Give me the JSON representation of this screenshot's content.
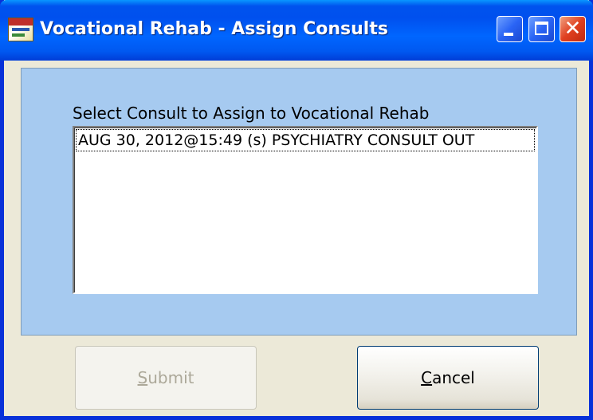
{
  "window": {
    "title": "Vocational Rehab - Assign Consults",
    "buttons": {
      "minimize_icon": "minimize-icon",
      "maximize_icon": "maximize-icon",
      "close_icon": "close-icon"
    }
  },
  "form": {
    "list_label": "Select Consult to Assign to Vocational Rehab",
    "items": [
      {
        "label": "AUG 30, 2012@15:49 (s) PSYCHIATRY CONSULT OUT"
      }
    ],
    "submit": {
      "accel": "S",
      "rest": "ubmit",
      "enabled": false
    },
    "cancel": {
      "accel": "C",
      "rest": "ancel",
      "enabled": true
    }
  },
  "colors": {
    "titlebar": "#0058f0",
    "panel": "#a6caf0",
    "window_bg": "#ece9d8"
  }
}
